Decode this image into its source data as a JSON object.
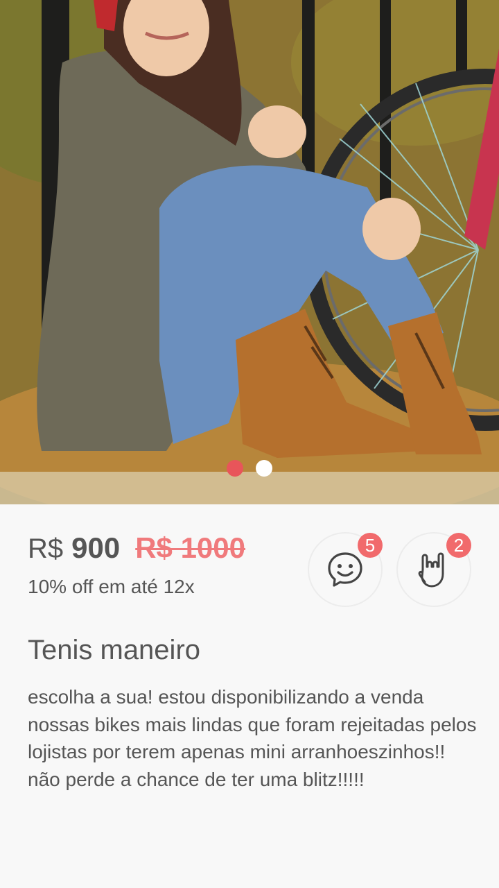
{
  "carousel": {
    "image_alt": "Girl sitting with boots next to bicycle in autumn leaves",
    "dots": [
      {
        "state": "active",
        "color": "#e8555a"
      },
      {
        "state": "inactive",
        "color": "#ffffff"
      }
    ]
  },
  "product": {
    "currency": "R$",
    "price": "900",
    "old_price": "R$ 1000",
    "installments": "10% off em até 12x",
    "title": "Tenis maneiro",
    "description": "escolha a sua! estou disponibilizando a venda nossas bikes mais lindas que foram rejeitadas pelos lojistas por terem apenas mini arranhoeszinhos!! não perde a chance de ter uma blitz!!!!!"
  },
  "actions": {
    "chat": {
      "icon": "smiley-chat-icon",
      "count": "5"
    },
    "rock": {
      "icon": "rock-hand-icon",
      "count": "2"
    }
  },
  "colors": {
    "accent": "#f16a6c",
    "text": "#555555",
    "background": "#f8f8f8"
  }
}
